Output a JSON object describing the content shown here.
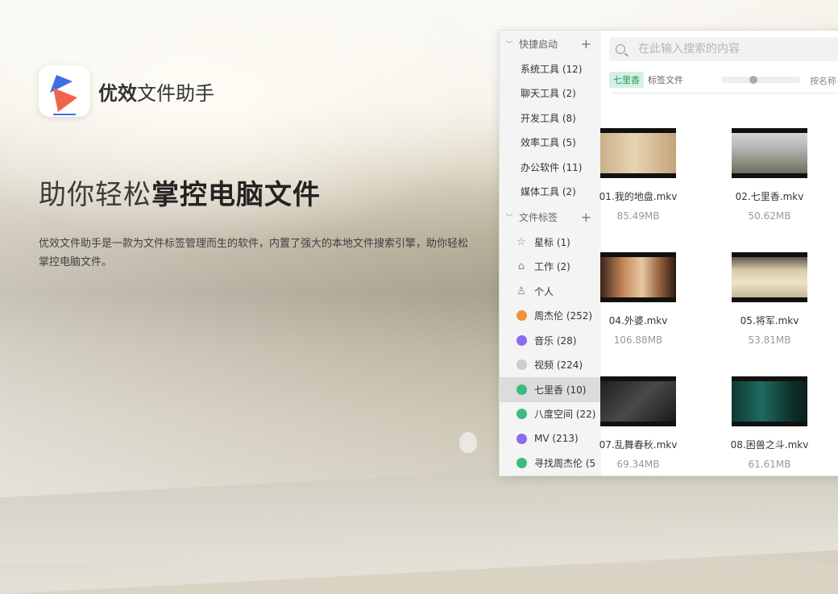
{
  "brand": {
    "name_bold": "优效",
    "name_rest": "文件助手"
  },
  "hero": {
    "headline_light": "助你轻松",
    "headline_bold": "掌控电脑文件",
    "description": "优效文件助手是一款为文件标签管理而生的软件，内置了强大的本地文件搜索引擎，助你轻松掌控电脑文件。"
  },
  "sidebar": {
    "quick": {
      "title": "快捷启动",
      "items": [
        {
          "label": "系统工具 (12)"
        },
        {
          "label": "聊天工具 (2)"
        },
        {
          "label": "开发工具 (8)"
        },
        {
          "label": "效率工具 (5)"
        },
        {
          "label": "办公软件 (11)"
        },
        {
          "label": "媒体工具 (2)"
        }
      ]
    },
    "tags": {
      "title": "文件标签",
      "items": [
        {
          "label": "星标 (1)",
          "icon": "star-icon"
        },
        {
          "label": "工作 (2)",
          "icon": "home-icon"
        },
        {
          "label": "个人",
          "icon": "user-icon"
        },
        {
          "label": "周杰伦 (252)",
          "color": "#f0913a"
        },
        {
          "label": "音乐 (28)",
          "color": "#8a6cf0"
        },
        {
          "label": "视频 (224)",
          "color": "#cccccc"
        },
        {
          "label": "七里香 (10)",
          "color": "#3dba7e",
          "active": true
        },
        {
          "label": "八度空间 (22)",
          "color": "#3dba7e"
        },
        {
          "label": "MV (213)",
          "color": "#8a6cf0"
        },
        {
          "label": "寻找周杰伦 (5",
          "color": "#3dba7e"
        }
      ]
    }
  },
  "main": {
    "search_placeholder": "在此输入搜索的内容",
    "filter": {
      "tag": "七里香",
      "label": "标签文件",
      "sort": "按名称"
    },
    "slider_value": 0.4,
    "files": [
      {
        "name": "01.我的地盘.mkv",
        "size": "85.49MB"
      },
      {
        "name": "02.七里香.mkv",
        "size": "50.62MB"
      },
      {
        "name": "04.外婆.mkv",
        "size": "106.88MB"
      },
      {
        "name": "05.将军.mkv",
        "size": "53.81MB"
      },
      {
        "name": "07.乱舞春秋.mkv",
        "size": "69.34MB"
      },
      {
        "name": "08.困兽之斗.mkv",
        "size": "61.61MB"
      }
    ]
  }
}
